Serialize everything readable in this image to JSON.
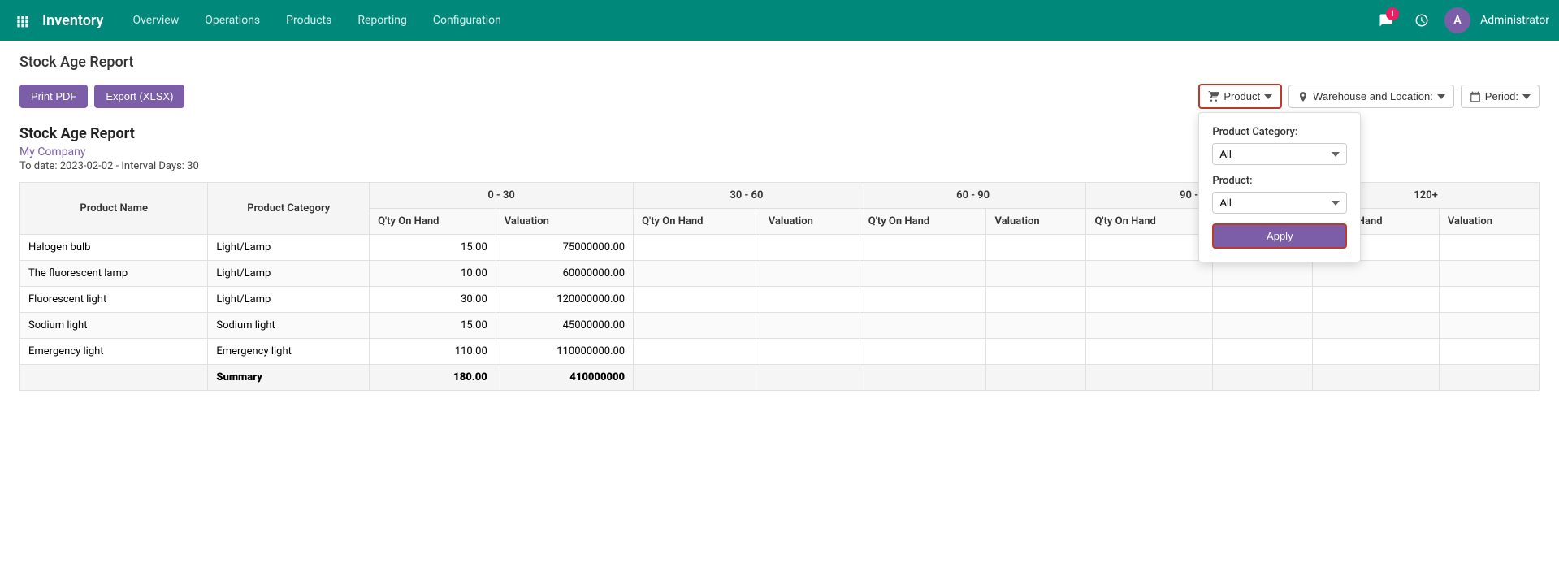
{
  "nav": {
    "brand": "Inventory",
    "menu": [
      "Overview",
      "Operations",
      "Products",
      "Reporting",
      "Configuration"
    ],
    "badge_count": "1",
    "username": "Administrator",
    "avatar_letter": "A"
  },
  "page": {
    "title": "Stock Age Report",
    "buttons": {
      "print_pdf": "Print PDF",
      "export_xlsx": "Export (XLSX)"
    },
    "filters": {
      "product_label": "Product",
      "warehouse_location_label": "Warehouse and Location:",
      "period_label": "Period:"
    },
    "dropdown": {
      "category_label": "Product Category:",
      "category_options": [
        "All"
      ],
      "product_label": "Product:",
      "product_options": [
        "All"
      ],
      "apply_label": "Apply"
    }
  },
  "report": {
    "title": "Stock Age Report",
    "company": "My Company",
    "date_info": "To date: 2023-02-02 - Interval Days: 30",
    "columns": {
      "product_name": "Product Name",
      "product_category": "Product Category",
      "ranges": [
        "0 - 30",
        "30 - 60",
        "60 - 90",
        "90 - 120",
        "120+"
      ],
      "qty_on_hand": "Q'ty On Hand",
      "valuation": "Valuation"
    },
    "rows": [
      {
        "name": "Halogen bulb",
        "category": "Light/Lamp",
        "qty_0_30": "15.00",
        "val_0_30": "75000000.00",
        "qty_30_60": "",
        "val_30_60": "",
        "qty_60_90": "",
        "val_60_90": "",
        "qty_90_120": "",
        "val_90_120": "",
        "qty_120": "",
        "val_120": ""
      },
      {
        "name": "The fluorescent lamp",
        "category": "Light/Lamp",
        "qty_0_30": "10.00",
        "val_0_30": "60000000.00",
        "qty_30_60": "",
        "val_30_60": "",
        "qty_60_90": "",
        "val_60_90": "",
        "qty_90_120": "",
        "val_90_120": "",
        "qty_120": "",
        "val_120": ""
      },
      {
        "name": "Fluorescent light",
        "category": "Light/Lamp",
        "qty_0_30": "30.00",
        "val_0_30": "120000000.00",
        "qty_30_60": "",
        "val_30_60": "",
        "qty_60_90": "",
        "val_60_90": "",
        "qty_90_120": "",
        "val_90_120": "",
        "qty_120": "",
        "val_120": ""
      },
      {
        "name": "Sodium light",
        "category": "Sodium light",
        "qty_0_30": "15.00",
        "val_0_30": "45000000.00",
        "qty_30_60": "",
        "val_30_60": "",
        "qty_60_90": "",
        "val_60_90": "",
        "qty_90_120": "",
        "val_90_120": "",
        "qty_120": "",
        "val_120": ""
      },
      {
        "name": "Emergency light",
        "category": "Emergency light",
        "qty_0_30": "110.00",
        "val_0_30": "110000000.00",
        "qty_30_60": "",
        "val_30_60": "",
        "qty_60_90": "",
        "val_60_90": "",
        "qty_90_120": "",
        "val_90_120": "",
        "qty_120": "",
        "val_120": ""
      }
    ],
    "summary": {
      "label": "Summary",
      "qty_0_30": "180.00",
      "val_0_30": "410000000",
      "qty_30_60": "",
      "val_30_60": "",
      "qty_60_90": "",
      "val_60_90": "",
      "qty_90_120": "",
      "val_90_120": "",
      "qty_120": "",
      "val_120": ""
    }
  }
}
